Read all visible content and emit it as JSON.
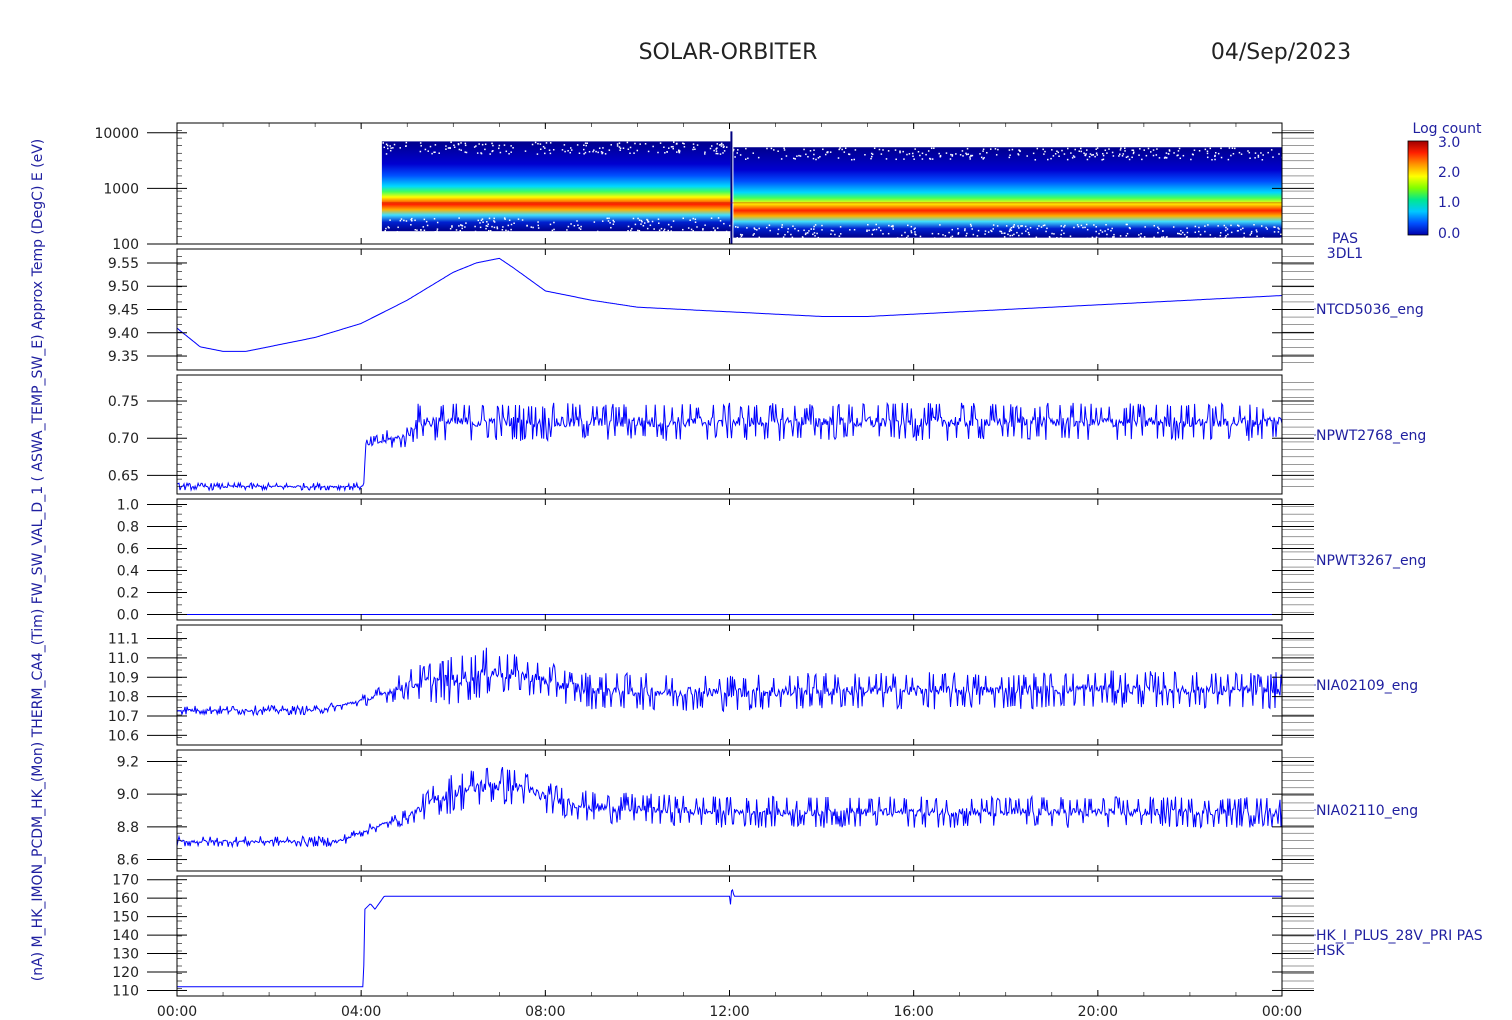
{
  "header": {
    "mission": "SOLAR-ORBITER",
    "date": "04/Sep/2023"
  },
  "colorbar": {
    "title": "Log count",
    "ticks": [
      "3.0",
      "2.0",
      "1.0",
      "0.0"
    ],
    "stops": [
      "#0000aa",
      "#0050ff",
      "#00c8ff",
      "#00e890",
      "#80ff00",
      "#ffff00",
      "#ff9600",
      "#ff2000",
      "#a00000"
    ]
  },
  "y_axis_title": "(nA) M_HK_IMON_PCDM_HK_(Mon) THERM_CA4_(Tim) FW_SW_VAL_D_1 ( ASWA_TEMP_SW_E) Approx Temp (DegC) E (eV)",
  "colors": {
    "trace": "#0000ff",
    "axis": "#000000",
    "label": "#2020a0"
  },
  "chart_data": [
    {
      "type": "heatmap",
      "panel_label": [
        "PAS",
        "3DL1"
      ],
      "ylabel": "E (eV)",
      "yscale": "log",
      "ylim": [
        100,
        15000
      ],
      "yticks": [
        "10000",
        "1000",
        "100"
      ],
      "data_start_hour": 4.45,
      "data_end_hour": 24,
      "upper_edge_ev": [
        7000,
        5500
      ],
      "lower_edge_ev": [
        170,
        130
      ],
      "peak_band_ev": [
        550,
        600
      ],
      "gap_hour": 12.02
    },
    {
      "type": "line",
      "label": "NTCD5036_eng",
      "ylabel": "Approx Temp (DegC)",
      "ylim": [
        9.32,
        9.58
      ],
      "yticks": [
        "9.55",
        "9.50",
        "9.45",
        "9.40",
        "9.35"
      ],
      "x": [
        0,
        0.5,
        1,
        1.5,
        2,
        3,
        4,
        5,
        6,
        6.5,
        7,
        7.3,
        8,
        9,
        10,
        11,
        12,
        13,
        14,
        15,
        16,
        17,
        18,
        19,
        20,
        21,
        22,
        23,
        24
      ],
      "values": [
        9.41,
        9.37,
        9.36,
        9.36,
        9.37,
        9.39,
        9.42,
        9.47,
        9.53,
        9.55,
        9.56,
        9.54,
        9.49,
        9.47,
        9.455,
        9.45,
        9.445,
        9.44,
        9.435,
        9.435,
        9.44,
        9.445,
        9.45,
        9.455,
        9.46,
        9.465,
        9.47,
        9.475,
        9.48
      ]
    },
    {
      "type": "line",
      "label": "NPWT2768_eng",
      "ylabel": "ASWA_TEMP_SW_E",
      "ylim": [
        0.625,
        0.785
      ],
      "yticks": [
        "0.75",
        "0.70",
        "0.65"
      ],
      "x": [
        0,
        4.05,
        4.1,
        4.5,
        5,
        5.2,
        24
      ],
      "values": [
        0.635,
        0.635,
        0.69,
        0.697,
        0.702,
        0.722,
        0.722
      ],
      "noise": [
        0.003,
        0.003,
        0.006,
        0.008,
        0.01,
        0.016,
        0.016
      ]
    },
    {
      "type": "line",
      "label": "NPWT3267_eng",
      "ylabel": "FW_SW_VAL_D_1",
      "ylim": [
        -0.05,
        1.05
      ],
      "yticks": [
        "1.0",
        "0.8",
        "0.6",
        "0.4",
        "0.2",
        "0.0"
      ],
      "x": [
        0,
        24
      ],
      "values": [
        0,
        0
      ]
    },
    {
      "type": "line",
      "label": "NIA02109_eng",
      "ylabel": "THERM_CA4_(Tim)",
      "ylim": [
        10.55,
        11.17
      ],
      "yticks": [
        "11.1",
        "11.0",
        "10.9",
        "10.8",
        "10.7",
        "10.6"
      ],
      "x": [
        0,
        3,
        3.5,
        4.2,
        5,
        5.5,
        6,
        6.8,
        7.5,
        8,
        9,
        12,
        14,
        18,
        20,
        24
      ],
      "values": [
        10.73,
        10.73,
        10.75,
        10.79,
        10.86,
        10.88,
        10.88,
        10.93,
        10.91,
        10.88,
        10.83,
        10.82,
        10.83,
        10.83,
        10.84,
        10.83
      ],
      "noise": [
        0.015,
        0.015,
        0.015,
        0.02,
        0.05,
        0.07,
        0.08,
        0.08,
        0.06,
        0.06,
        0.06,
        0.06,
        0.06,
        0.06,
        0.06,
        0.06
      ]
    },
    {
      "type": "line",
      "label": "NIA02110_eng",
      "ylabel": "M_HK_IMON_PCDM_HK_(Mon)",
      "ylim": [
        8.53,
        9.27
      ],
      "yticks": [
        "9.2",
        "9.0",
        "8.8",
        "8.6"
      ],
      "x": [
        0,
        3.5,
        4.2,
        5,
        5.5,
        6,
        6.8,
        7.5,
        8,
        9,
        12,
        24
      ],
      "values": [
        8.71,
        8.71,
        8.79,
        8.86,
        8.95,
        9.01,
        9.06,
        9.04,
        8.98,
        8.92,
        8.89,
        8.89
      ],
      "noise": [
        0.02,
        0.02,
        0.02,
        0.03,
        0.06,
        0.08,
        0.08,
        0.07,
        0.06,
        0.06,
        0.06,
        0.06
      ]
    },
    {
      "type": "line",
      "label": [
        "HK_I_PLUS_28V_PRI PAS",
        "HSK"
      ],
      "ylabel": "(nA)",
      "ylim": [
        107,
        172
      ],
      "yticks": [
        "170",
        "160",
        "150",
        "140",
        "130",
        "120",
        "110"
      ],
      "x": [
        0,
        4.05,
        4.08,
        4.2,
        4.3,
        4.5,
        12.0,
        12.02,
        12.05,
        12.1,
        24
      ],
      "values": [
        112,
        112,
        154,
        157,
        154,
        161,
        161,
        156,
        166,
        161,
        161
      ]
    }
  ],
  "x_axis": {
    "range_hours": [
      0,
      24
    ],
    "tick_labels": [
      "00:00",
      "04:00",
      "08:00",
      "12:00",
      "16:00",
      "20:00",
      "00:00"
    ]
  }
}
